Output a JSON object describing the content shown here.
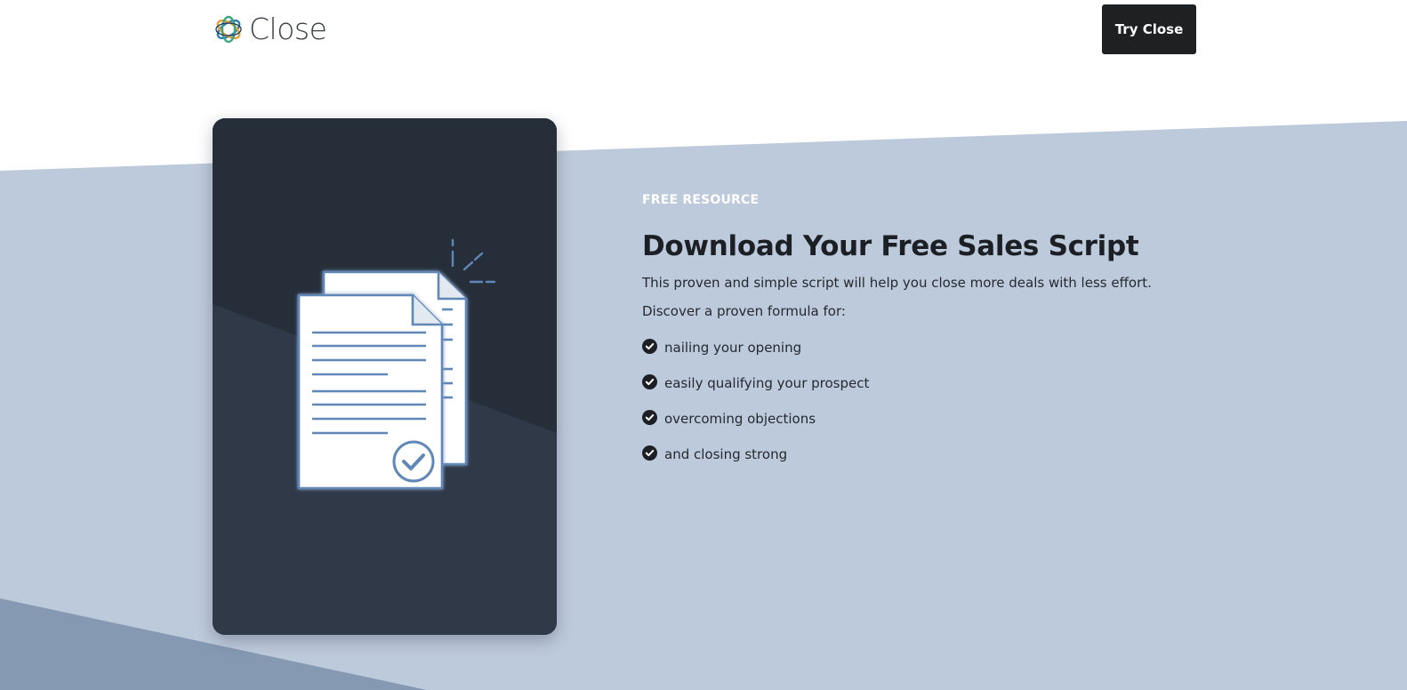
{
  "header": {
    "logo_text": "Close",
    "cta_label": "Try Close"
  },
  "hero": {
    "eyebrow": "FREE RESOURCE",
    "title": "Download Your Free Sales Script",
    "description": "This proven and simple script will help you close more deals with less effort.",
    "formula_intro": "Discover a proven formula for:",
    "benefits": [
      "nailing your opening",
      "easily qualifying your prospect",
      "overcoming objections",
      "and closing strong"
    ]
  },
  "colors": {
    "band_light": "#bdcadc",
    "band_dark": "#8599b2",
    "card_dark": "#262e3a",
    "card_light": "#2f3947",
    "doc_stroke": "#5f87b8",
    "cta_bg": "#1f2022"
  },
  "icons": {
    "logo": "close-logo-icon",
    "document": "documents-check-icon",
    "bullet": "check-circle-icon"
  }
}
